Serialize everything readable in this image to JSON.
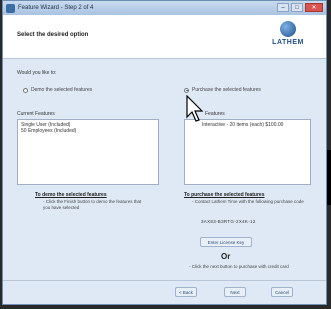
{
  "window": {
    "title": "Feature Wizard - Step 2 of 4"
  },
  "header": {
    "title": "Select the desired option",
    "logo_text": "LATHEM"
  },
  "prompt": "Would you like to:",
  "options": {
    "demo_label": "Demo the selected features",
    "purchase_label": "Purchase the selected features",
    "selected": "purchase"
  },
  "current_features": {
    "label": "Current Features",
    "items": [
      "Single User (Included)",
      "50 Employees (Included)"
    ]
  },
  "selected_features": {
    "label": "Features",
    "items": [
      "Interactive - 20 items (each) $100.00"
    ]
  },
  "demo_section": {
    "heading": "To demo the selected features",
    "text": "- Click the Finish button to demo the features that you have selected"
  },
  "purchase_section": {
    "heading": "To purchase the selected features",
    "text": "- Contact Lathem Time with the following purchase code",
    "code": "3AX83-B3RTG-2X4K-12",
    "license_button": "Enter License Key",
    "or": "Or",
    "next_text": "- Click the next button to purchase with credit card"
  },
  "footer": {
    "back": "< Back",
    "next": "Next",
    "cancel": "Cancel"
  }
}
